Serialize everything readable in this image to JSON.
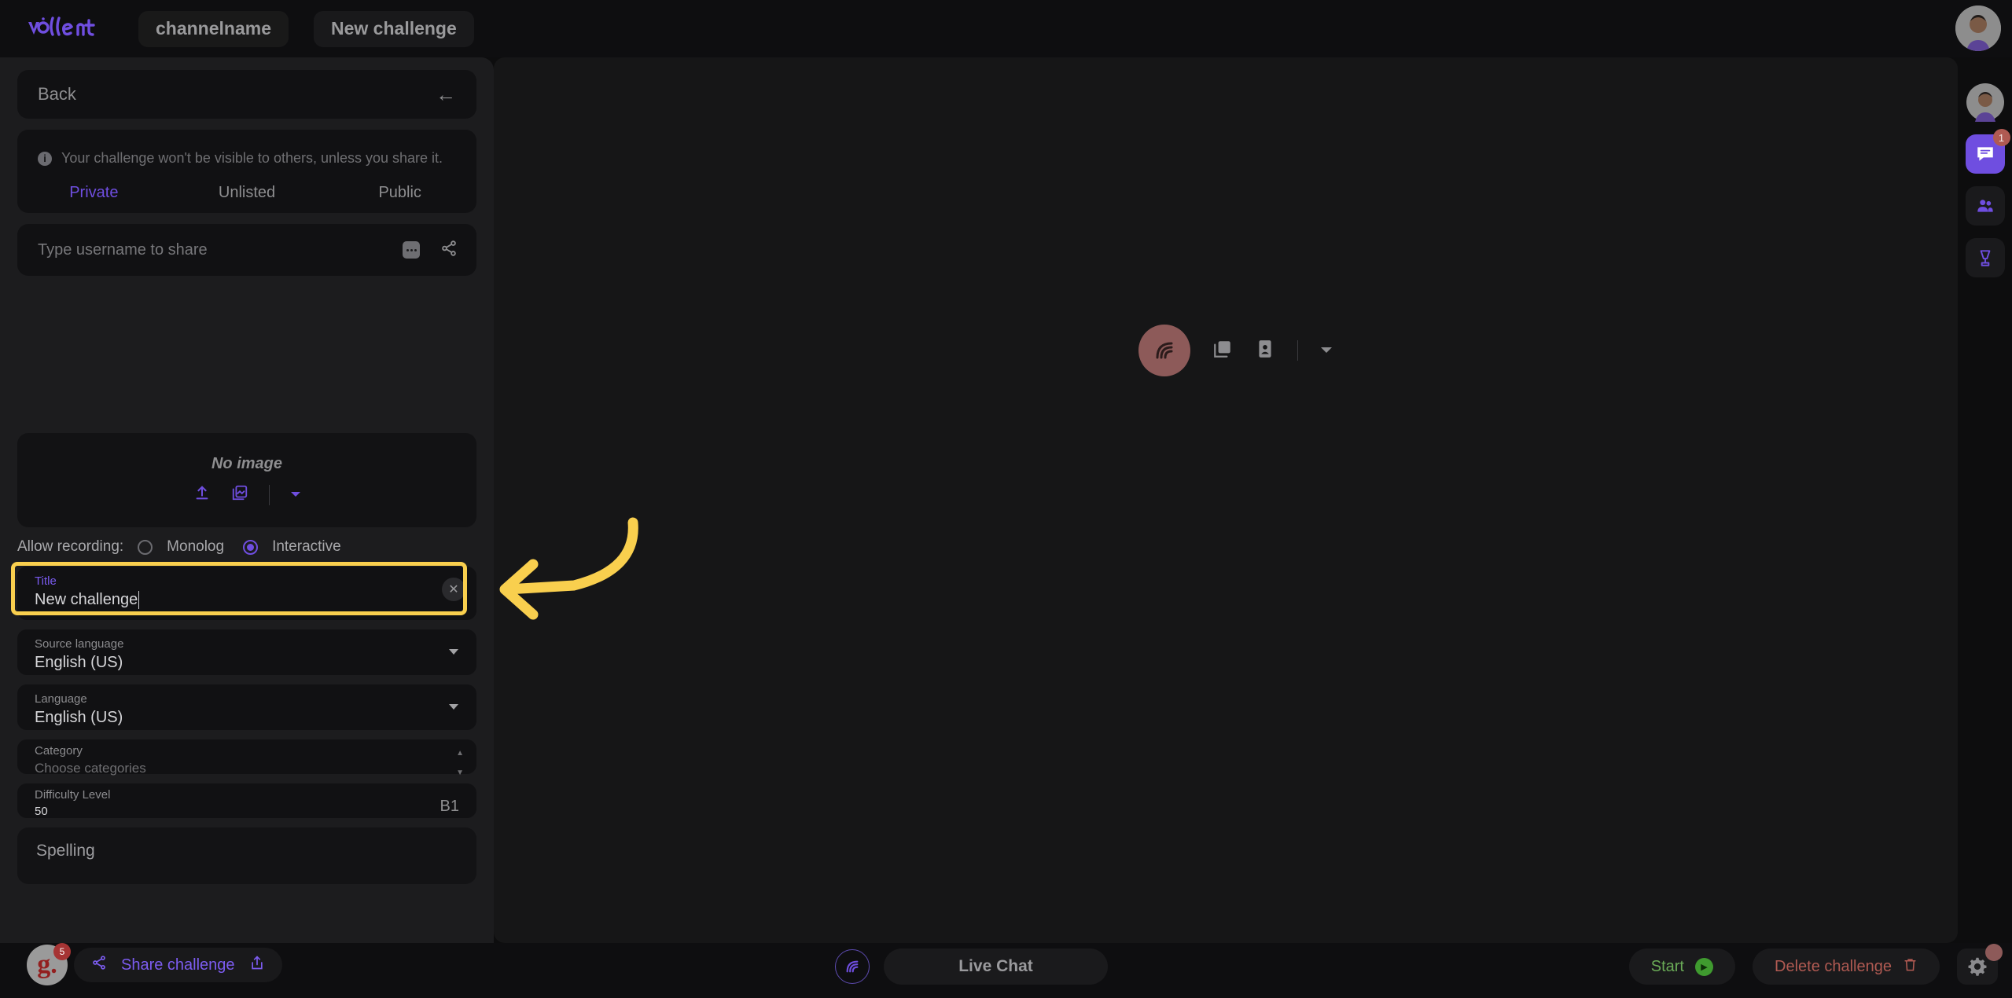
{
  "app": {
    "brand": "vollent",
    "channel_chip": "channelname",
    "challenge_chip": "New challenge"
  },
  "left_panel": {
    "back_label": "Back",
    "notice": "Your challenge won't be visible to others, unless you share it.",
    "visibility_tabs": [
      {
        "label": "Private",
        "active": true
      },
      {
        "label": "Unlisted",
        "active": false
      },
      {
        "label": "Public",
        "active": false
      }
    ],
    "share_input_placeholder": "Type username to share",
    "image_area": {
      "empty_label": "No image",
      "upload_icon": "upload-icon",
      "gallery_icon": "gallery-icon",
      "dropdown_icon": "chevron-down-icon"
    },
    "recording": {
      "label": "Allow recording:",
      "options": [
        {
          "label": "Monolog",
          "selected": false
        },
        {
          "label": "Interactive",
          "selected": true
        }
      ]
    },
    "fields": {
      "title": {
        "label": "Title",
        "value": "New challenge"
      },
      "source_language": {
        "label": "Source language",
        "value": "English (US)"
      },
      "language": {
        "label": "Language",
        "value": "English (US)"
      },
      "category": {
        "label": "Category",
        "placeholder": "Choose categories"
      },
      "difficulty": {
        "label": "Difficulty Level",
        "value": "50",
        "cefr": "B1"
      },
      "spelling": {
        "label": "Spelling"
      }
    }
  },
  "stage": {
    "avatar_icon": "signal-wave-icon",
    "gallery_icon": "gallery-icon",
    "contact_card_icon": "contact-card-icon",
    "dropdown_icon": "chevron-down-icon"
  },
  "right_rail": {
    "items": [
      {
        "name": "avatar",
        "icon": "user-avatar-icon",
        "badge": null
      },
      {
        "name": "chat",
        "icon": "chat-bubble-icon",
        "badge": "1"
      },
      {
        "name": "participants",
        "icon": "people-icon",
        "badge": null
      },
      {
        "name": "tools",
        "icon": "blender-icon",
        "badge": null
      }
    ]
  },
  "bottom_bar": {
    "profile_logo": "g.",
    "profile_badge": "5",
    "share_challenge": "Share challenge",
    "live_chat": "Live Chat",
    "start": "Start",
    "delete_challenge": "Delete challenge",
    "settings_icon": "gear-icon"
  },
  "annotation": {
    "arrow": "curved-left-arrow",
    "color": "#f9cf4e",
    "highlight_target": "title-field"
  },
  "colors": {
    "accent_purple": "#6f4ee0",
    "annotation_yellow": "#f9cf4e",
    "start_green": "#6aab57",
    "delete_red": "#b05a52",
    "panel_bg": "#1c1c1e",
    "card_bg": "#111113",
    "stage_bg": "#161617"
  }
}
